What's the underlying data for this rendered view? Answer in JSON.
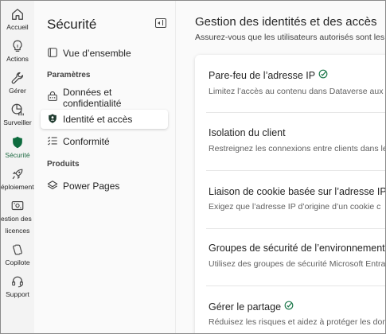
{
  "rail": {
    "items": [
      {
        "label": "Accueil",
        "icon": "home-icon"
      },
      {
        "label": "Actions",
        "icon": "lightbulb-icon"
      },
      {
        "label": "Gérer",
        "icon": "wrench-icon"
      },
      {
        "label": "Surveiller",
        "icon": "chart-icon"
      },
      {
        "label": "Sécurité",
        "icon": "shield-icon",
        "active": true
      },
      {
        "label": "éploiement",
        "icon": "rocket-icon"
      },
      {
        "label": "estion des",
        "label2": "licences",
        "icon": "license-icon"
      },
      {
        "label": "Copilote",
        "icon": "copilot-icon"
      },
      {
        "label": "Support",
        "icon": "headset-icon"
      }
    ]
  },
  "nav": {
    "title": "Sécurité",
    "overview": "Vue d’ensemble",
    "section_settings": "Paramètres",
    "data_privacy": "Données et confidentialité",
    "identity_access": "Identité et accès",
    "compliance": "Conformité",
    "section_products": "Produits",
    "power_pages": "Power Pages"
  },
  "main": {
    "title": "Gestion des identités et des accès",
    "subtitle": "Assurez-vous que les utilisateurs autorisés sont les",
    "rows": [
      {
        "title": "Pare-feu de l’adresse IP",
        "desc": "Limitez l’accès au contenu dans Dataverse aux",
        "badge": true
      },
      {
        "title": "Isolation du client",
        "desc": "Restreignez les connexions entre clients dans le",
        "badge": false
      },
      {
        "title": "Liaison de cookie basée sur l’adresse IP",
        "desc": "Exigez que l’adresse IP d’origine d’un cookie c",
        "badge": true
      },
      {
        "title": "Groupes de sécurité de l’environnement",
        "desc": "Utilisez des groupes de sécurité Microsoft Entra",
        "badge": false
      },
      {
        "title": "Gérer le partage",
        "desc": "Réduisez les risques et aidez à protéger les don",
        "badge": true
      }
    ]
  },
  "colors": {
    "accent": "#1f7a4d",
    "active_icon": "#0e6b3e",
    "text": "#242424",
    "muted": "#616161"
  }
}
